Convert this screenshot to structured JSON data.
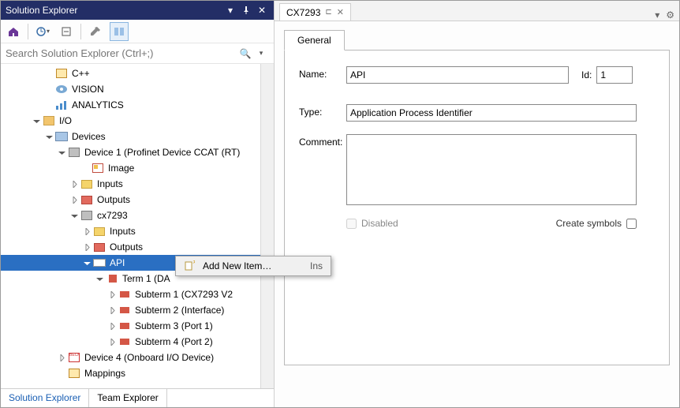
{
  "panel": {
    "title": "Solution Explorer"
  },
  "search": {
    "placeholder": "Search Solution Explorer (Ctrl+;)"
  },
  "tree": {
    "n0": "C++",
    "n1": "VISION",
    "n2": "ANALYTICS",
    "n3": "I/O",
    "n4": "Devices",
    "n5": "Device 1 (Profinet Device CCAT (RT)",
    "n6": "Image",
    "n7": "Inputs",
    "n8": "Outputs",
    "n9": "cx7293",
    "n10": "Inputs",
    "n11": "Outputs",
    "n12": "API",
    "n13": "Term 1 (DA",
    "n14": "Subterm 1 (CX7293 V2",
    "n15": "Subterm 2 (Interface)",
    "n16": "Subterm 3 (Port 1)",
    "n17": "Subterm 4 (Port 2)",
    "n18": "Device 4 (Onboard I/O Device)",
    "n19": "Mappings"
  },
  "ctx": {
    "add": "Add New Item…",
    "sc": "Ins"
  },
  "btabs": {
    "a": "Solution Explorer",
    "b": "Team Explorer"
  },
  "doc": {
    "t1": "CX7293"
  },
  "prop": {
    "tab": "General",
    "name_l": "Name:",
    "name_v": "API",
    "id_l": "Id:",
    "id_v": "1",
    "type_l": "Type:",
    "type_v": "Application Process Identifier",
    "comment_l": "Comment:",
    "comment_v": "",
    "disabled": "Disabled",
    "createsym": "Create symbols"
  }
}
